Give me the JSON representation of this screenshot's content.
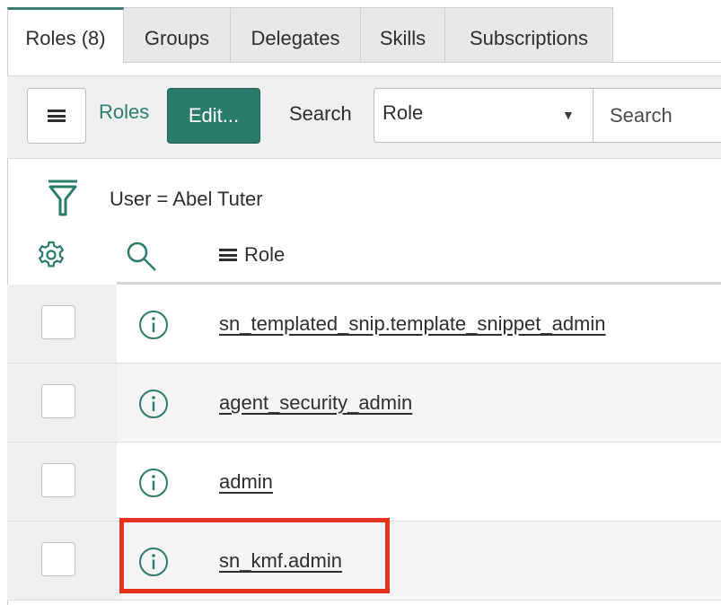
{
  "tabs": [
    {
      "label": "Roles (8)",
      "active": true
    },
    {
      "label": "Groups",
      "active": false
    },
    {
      "label": "Delegates",
      "active": false
    },
    {
      "label": "Skills",
      "active": false
    },
    {
      "label": "Subscriptions",
      "active": false
    }
  ],
  "toolbar": {
    "menu_icon": "hamburger-icon",
    "roles_link": "Roles",
    "edit_label": "Edit...",
    "search_label": "Search",
    "field_select_value": "Role",
    "search_placeholder": "Search"
  },
  "filter": {
    "icon": "funnel-icon",
    "text": "User = Abel Tuter"
  },
  "list_header": {
    "settings_icon": "gear-icon",
    "search_icon": "search-icon",
    "column_label": "Role"
  },
  "rows": [
    {
      "role": "sn_templated_snip.template_snippet_admin",
      "info_icon": "info-icon"
    },
    {
      "role": "agent_security_admin",
      "info_icon": "info-icon"
    },
    {
      "role": "admin",
      "info_icon": "info-icon"
    },
    {
      "role": "sn_kmf.admin",
      "info_icon": "info-icon"
    }
  ],
  "colors": {
    "accent": "#2b7b6b",
    "link_accent": "#2f7d6d",
    "highlight": "#e8311d",
    "toolbar_bg": "#eef0f0"
  }
}
